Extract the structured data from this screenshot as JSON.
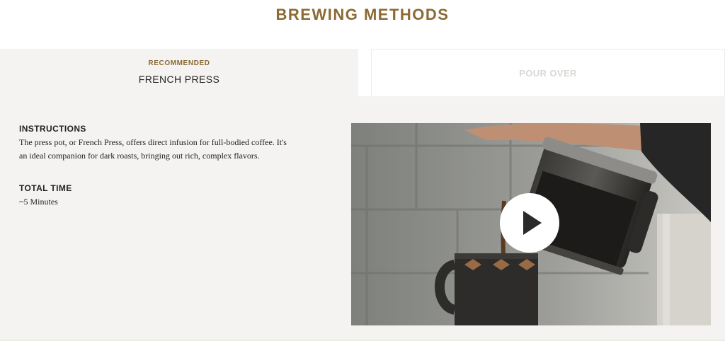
{
  "page": {
    "title": "BREWING METHODS"
  },
  "tabs": [
    {
      "eyebrow": "RECOMMENDED",
      "label": "FRENCH PRESS",
      "active": true
    },
    {
      "label": "POUR OVER",
      "active": false
    }
  ],
  "details": {
    "instructions_heading": "INSTRUCTIONS",
    "instructions_line1": "The press pot, or French Press, offers direct infusion for full-bodied coffee. It's",
    "instructions_line2": "an ideal companion for dark roasts, bringing out rich, complex flavors.",
    "total_time_heading": "TOTAL TIME",
    "total_time_value": "~5 Minutes"
  },
  "video": {
    "play_icon": "play-icon"
  },
  "colors": {
    "accent": "#8b6a33",
    "panel_bg": "#f4f3f1",
    "text": "#222222",
    "inactive_tab_text": "#d9d8d5"
  }
}
